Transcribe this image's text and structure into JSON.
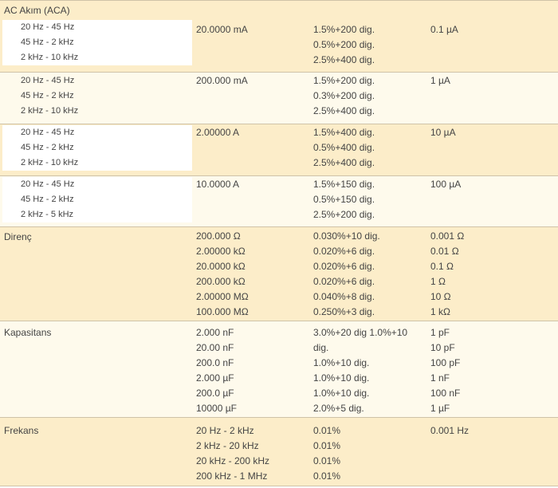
{
  "aca": {
    "title": "AC Akım (ACA)",
    "groups": [
      {
        "freqs": [
          "20 Hz - 45 Hz",
          "45 Hz - 2 kHz",
          "2 kHz - 10 kHz"
        ],
        "range": "20.0000 mA",
        "acc": [
          "1.5%+200 dig.",
          "0.5%+200 dig.",
          "2.5%+400 dig."
        ],
        "res": "0.1 µA"
      },
      {
        "freqs": [
          "20 Hz - 45 Hz",
          "45 Hz - 2 kHz",
          "2 kHz - 10 kHz"
        ],
        "range": "200.000 mA",
        "acc": [
          "1.5%+200 dig.",
          "0.3%+200 dig.",
          "2.5%+400 dig."
        ],
        "res": "1 µA"
      },
      {
        "freqs": [
          "20 Hz - 45 Hz",
          "45 Hz - 2 kHz",
          "2 kHz - 10 kHz"
        ],
        "range": "2.00000 A",
        "acc": [
          "1.5%+400 dig.",
          "0.5%+400 dig.",
          "2.5%+400 dig."
        ],
        "res": "10 µA"
      },
      {
        "freqs": [
          "20 Hz - 45 Hz",
          "45 Hz - 2 kHz",
          "2 kHz - 5 kHz"
        ],
        "range": "10.0000 A",
        "acc": [
          "1.5%+150 dig.",
          "0.5%+150 dig.",
          "2.5%+200 dig."
        ],
        "res": "100 µA"
      }
    ]
  },
  "resistance": {
    "title": "Direnç",
    "ranges": [
      "200.000 Ω",
      "2.00000 kΩ",
      "20.0000 kΩ",
      "200.000 kΩ",
      "2.00000 MΩ",
      "100.000 MΩ"
    ],
    "acc": [
      "0.030%+10 dig.",
      "0.020%+6 dig.",
      "0.020%+6 dig.",
      "0.020%+6 dig.",
      "0.040%+8 dig.",
      "0.250%+3 dig."
    ],
    "res": [
      "0.001 Ω",
      "0.01 Ω",
      "0.1 Ω",
      "1 Ω",
      "10 Ω",
      "1 kΩ"
    ]
  },
  "capacitance": {
    "title": "Kapasitans",
    "ranges": [
      "2.000 nF",
      "20.00 nF",
      "200.0 nF",
      "2.000 µF",
      "200.0 µF",
      "10000 µF"
    ],
    "acc": [
      "3.0%+20 dig 1.0%+10",
      "dig.",
      "1.0%+10 dig.",
      "1.0%+10 dig.",
      "1.0%+10 dig.",
      "2.0%+5 dig."
    ],
    "res": [
      "1 pF",
      "10 pF",
      "100 pF",
      "1 nF",
      "100 nF",
      "1 µF"
    ]
  },
  "frequency": {
    "title": "Frekans",
    "ranges": [
      "20 Hz - 2 kHz",
      "2 kHz - 20 kHz",
      "20 kHz - 200 kHz",
      "200 kHz - 1 MHz"
    ],
    "acc": [
      "0.01%",
      "0.01%",
      "0.01%",
      "0.01%"
    ],
    "res": "0.001 Hz"
  }
}
